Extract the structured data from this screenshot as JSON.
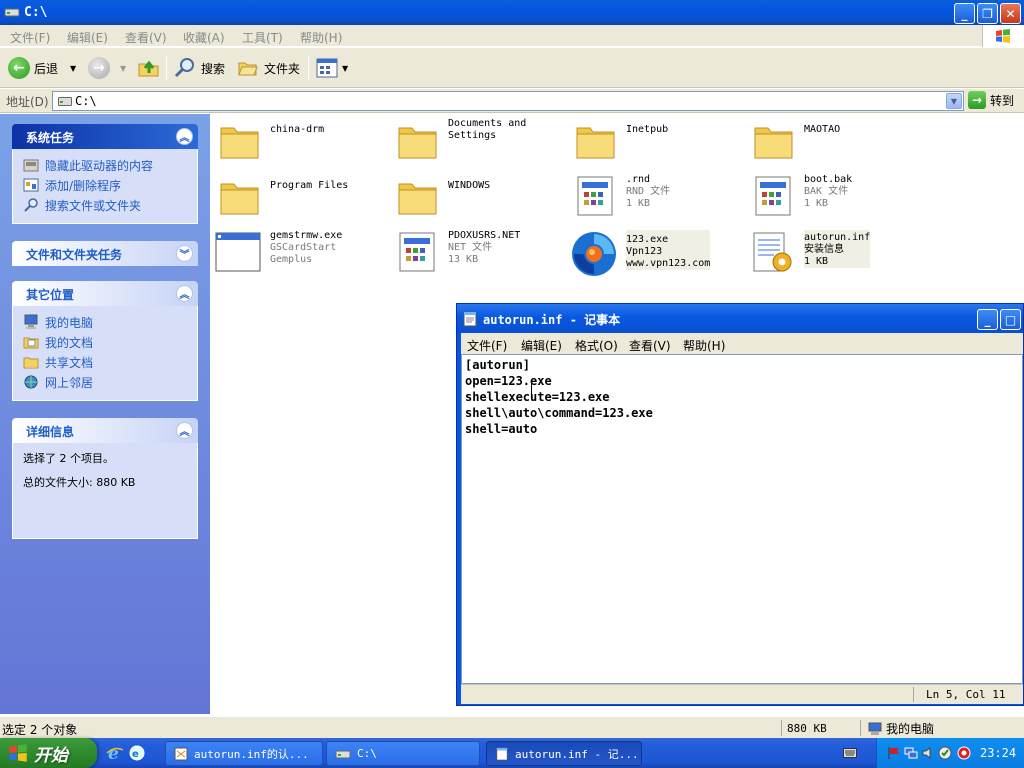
{
  "window": {
    "title": "C:\\"
  },
  "menubar": {
    "items": [
      "文件(F)",
      "编辑(E)",
      "查看(V)",
      "收藏(A)",
      "工具(T)",
      "帮助(H)"
    ]
  },
  "toolbar": {
    "back_label": "后退",
    "search_label": "搜索",
    "folders_label": "文件夹"
  },
  "address": {
    "label": "地址(D)",
    "value": "C:\\",
    "go_label": "转到"
  },
  "taskpane": {
    "system_tasks": {
      "title": "系统任务",
      "items": [
        "隐藏此驱动器的内容",
        "添加/删除程序",
        "搜索文件或文件夹"
      ]
    },
    "file_tasks": {
      "title": "文件和文件夹任务"
    },
    "other_places": {
      "title": "其它位置",
      "items": [
        "我的电脑",
        "我的文档",
        "共享文档",
        "网上邻居"
      ]
    },
    "details": {
      "title": "详细信息",
      "line1": "选择了 2 个项目。",
      "line2": "总的文件大小: 880 KB"
    }
  },
  "files": [
    {
      "name": "china-drm",
      "type": "folder"
    },
    {
      "name": "Documents and",
      "name2": "Settings",
      "type": "folder"
    },
    {
      "name": "Inetpub",
      "type": "folder"
    },
    {
      "name": "MAOTAO",
      "type": "folder"
    },
    {
      "name": "Program Files",
      "type": "folder"
    },
    {
      "name": "WINDOWS",
      "type": "folder"
    },
    {
      "name": ".rnd",
      "sub1": "RND 文件",
      "sub2": "1 KB",
      "type": "file"
    },
    {
      "name": "boot.bak",
      "sub1": "BAK 文件",
      "sub2": "1 KB",
      "type": "file"
    },
    {
      "name": "gemstrmw.exe",
      "sub1": "GSCardStart",
      "sub2": "Gemplus",
      "type": "exe"
    },
    {
      "name": "PDOXUSRS.NET",
      "sub1": "NET 文件",
      "sub2": "13 KB",
      "type": "file"
    },
    {
      "name": "123.exe",
      "sub1": "Vpn123",
      "sub2": "www.vpn123.com",
      "type": "vpn"
    },
    {
      "name": "autorun.inf",
      "sub1": "安装信息",
      "sub2": "1 KB",
      "type": "inf"
    }
  ],
  "notepad": {
    "title": "autorun.inf - 记事本",
    "menu": [
      "文件(F)",
      "编辑(E)",
      "格式(O)",
      "查看(V)",
      "帮助(H)"
    ],
    "lines": [
      "[autorun]",
      "open=123.exe",
      "shellexecute=123.exe",
      "shell\\auto\\command=123.exe",
      "shell=auto"
    ],
    "status": "Ln 5, Col 11"
  },
  "statusbar": {
    "left": "选定 2 个对象",
    "size": "880 KB",
    "zone": "我的电脑"
  },
  "taskbar": {
    "start": "开始",
    "tasks": [
      "autorun.inf的认...",
      "C:\\",
      "autorun.inf - 记..."
    ],
    "clock": "23:24"
  },
  "colors": {
    "title_blue": "#0554e3",
    "taskpane_blue": "#7ba2e7",
    "link_blue": "#215dc6",
    "start_green": "#2f8a2f"
  }
}
